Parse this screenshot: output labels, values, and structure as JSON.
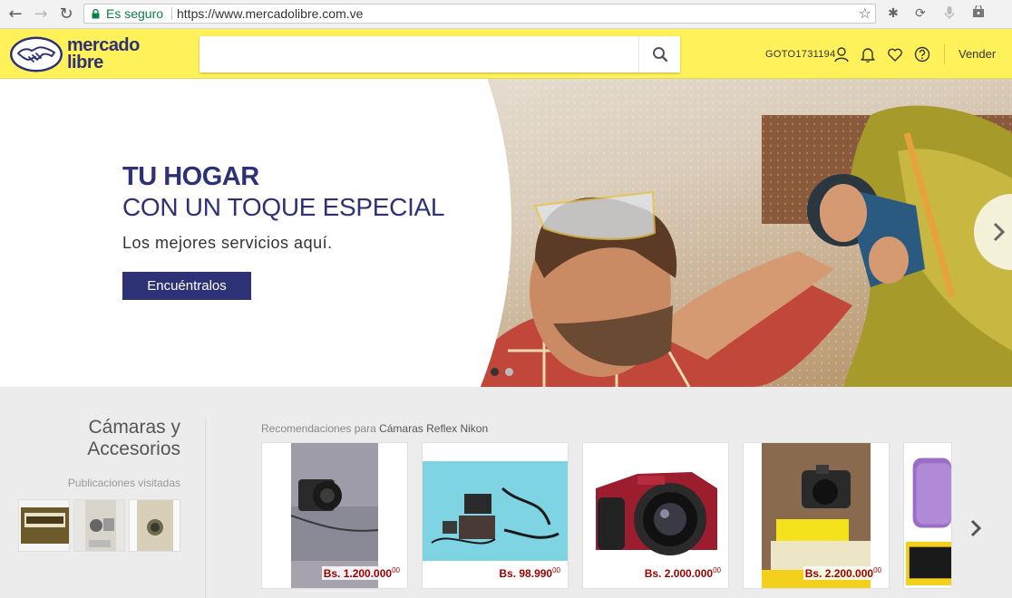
{
  "browser": {
    "secure_label": "Es seguro",
    "url": "https://www.mercadolibre.com.ve",
    "icons": [
      "back-arrow-icon",
      "forward-arrow-icon",
      "reload-icon",
      "lock-icon",
      "star-icon",
      "extension-icon",
      "sync-icon",
      "mic-icon",
      "lock-store-icon"
    ]
  },
  "header": {
    "logo_line1": "mercado",
    "logo_line2": "libre",
    "search_placeholder": "",
    "username": "GOTO1731194",
    "sell_label": "Vender",
    "icons": [
      "search-icon",
      "user-icon",
      "bell-icon",
      "heart-icon",
      "help-icon"
    ],
    "brand_color": "#fff159",
    "accent_color": "#2d3277"
  },
  "hero": {
    "title": "TU HOGAR",
    "subtitle": "CON UN TOQUE ESPECIAL",
    "tagline": "Los mejores servicios aquí.",
    "cta_label": "Encuéntralos",
    "slides": 2,
    "active_slide": 1
  },
  "category": {
    "title": "Cámaras y Accesorios",
    "visited_label": "Publicaciones visitadas",
    "visited_count": 3
  },
  "recommendations": {
    "label_prefix": "Recomendaciones para",
    "label_topic": "Cámaras Reflex Nikon",
    "items": [
      {
        "price": "Bs. 1.200.000",
        "cents": "00"
      },
      {
        "price": "Bs. 98.990",
        "cents": "00"
      },
      {
        "price": "Bs. 2.000.000",
        "cents": "00"
      },
      {
        "price": "Bs. 2.200.000",
        "cents": "00"
      }
    ]
  }
}
